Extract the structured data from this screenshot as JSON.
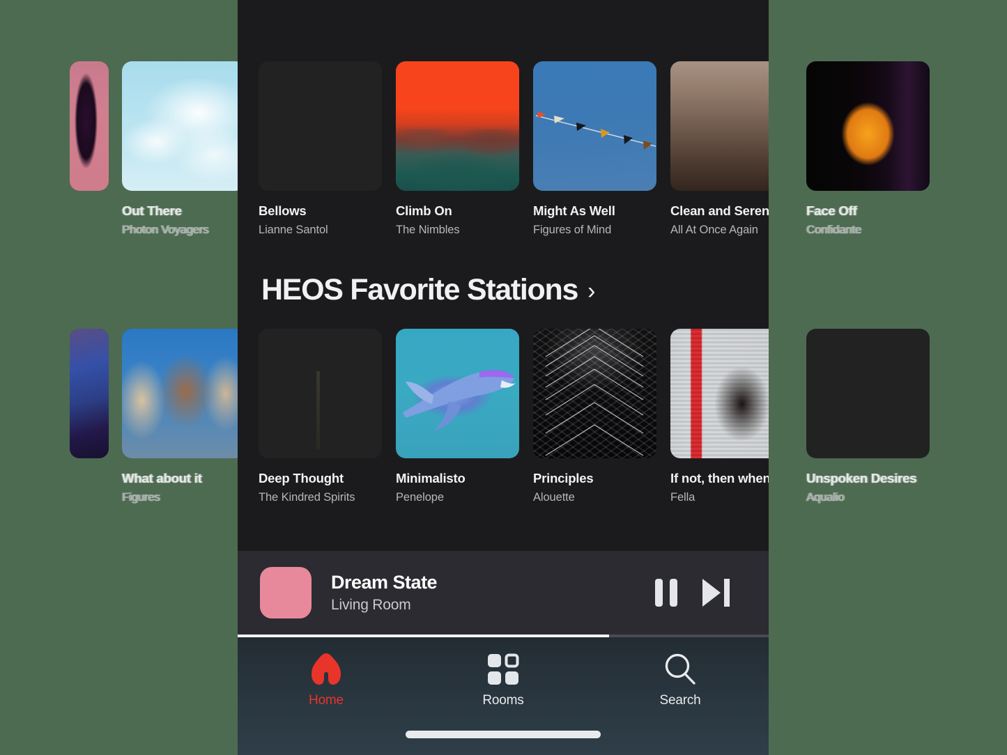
{
  "app": {
    "background_color": "#4d6b51",
    "frame_color": "#1b1b1d"
  },
  "rows": [
    {
      "id": "row-top",
      "cards": [
        {
          "title": "Out There",
          "artist": "Photon Voyagers",
          "art": "a-clouds",
          "outside": true
        },
        {
          "title": "Bellows",
          "artist": "Lianne Santol",
          "art": "a-portrait",
          "outside": false
        },
        {
          "title": "Climb On",
          "artist": "The Nimbles",
          "art": "a-sunset",
          "outside": false
        },
        {
          "title": "Might As Well",
          "artist": "Figures of Mind",
          "art": "a-sky",
          "outside": false
        },
        {
          "title": "Clean and Serene",
          "artist": "All At Once Again",
          "art": "a-water",
          "outside": false
        },
        {
          "title": "Face Off",
          "artist": "Confidante",
          "art": "a-bird",
          "outside": true
        }
      ]
    },
    {
      "id": "row-stations",
      "header": {
        "title": "HEOS Favorite Stations",
        "chevron": "›"
      },
      "cards": [
        {
          "title": "What about it",
          "artist": "Figures",
          "art": "a-field",
          "outside": true
        },
        {
          "title": "Deep Thought",
          "artist": "The Kindred Spirits",
          "art": "a-palm",
          "outside": false
        },
        {
          "title": "Minimalisto",
          "artist": "Penelope",
          "art": "a-shark",
          "outside": false
        },
        {
          "title": "Principles",
          "artist": "Alouette",
          "art": "a-chevron",
          "outside": false
        },
        {
          "title": "If not, then when?",
          "artist": "Fella",
          "art": "a-stripes",
          "outside": false
        },
        {
          "title": "Unspoken Desires",
          "artist": "Aqualio",
          "art": "a-blueman",
          "outside": true
        }
      ]
    }
  ],
  "now_playing": {
    "title": "Dream State",
    "room": "Living Room",
    "pause_icon": "pause-icon",
    "next_icon": "next-track-icon",
    "progress_percent": 70
  },
  "tabs": [
    {
      "label": "Home",
      "icon": "home-icon",
      "active": true,
      "color": "#e8342b"
    },
    {
      "label": "Rooms",
      "icon": "grid-icon",
      "active": false,
      "color": "#e9eaec"
    },
    {
      "label": "Search",
      "icon": "search-icon",
      "active": false,
      "color": "#e9eaec"
    }
  ]
}
